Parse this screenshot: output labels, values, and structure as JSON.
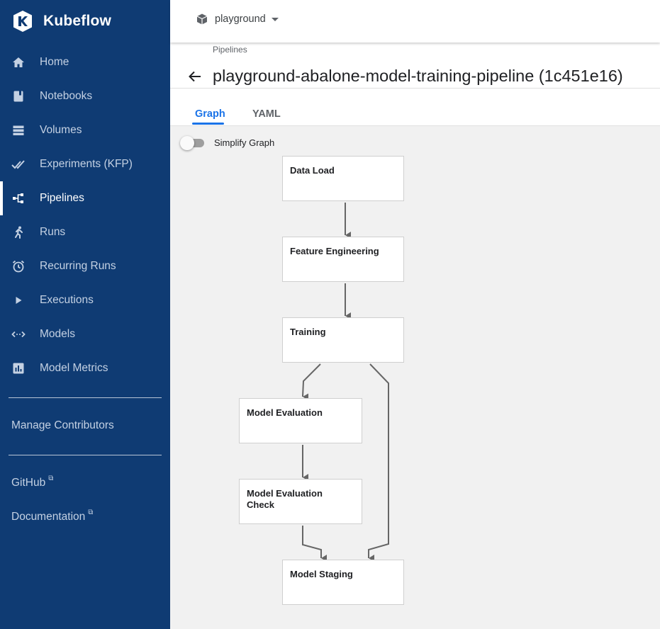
{
  "brand": {
    "name": "Kubeflow",
    "logo_icon": "kubeflow-logo-icon"
  },
  "sidebar": {
    "items": [
      {
        "label": "Home",
        "icon": "home-icon"
      },
      {
        "label": "Notebooks",
        "icon": "notebook-icon"
      },
      {
        "label": "Volumes",
        "icon": "storage-icon"
      },
      {
        "label": "Experiments (KFP)",
        "icon": "done-all-icon"
      },
      {
        "label": "Pipelines",
        "icon": "pipeline-icon",
        "active": true
      },
      {
        "label": "Runs",
        "icon": "runner-icon"
      },
      {
        "label": "Recurring Runs",
        "icon": "alarm-icon"
      },
      {
        "label": "Executions",
        "icon": "play-icon"
      },
      {
        "label": "Models",
        "icon": "code-arrows-icon"
      },
      {
        "label": "Model Metrics",
        "icon": "bar-chart-icon"
      }
    ],
    "manage_contributors": "Manage Contributors",
    "github": "GitHub",
    "documentation": "Documentation"
  },
  "topbar": {
    "namespace": "playground"
  },
  "header": {
    "breadcrumb": "Pipelines",
    "title": "playground-abalone-model-training-pipeline (1c451e16)"
  },
  "tabs": {
    "graph": "Graph",
    "yaml": "YAML",
    "active": "graph"
  },
  "graph": {
    "simplify_label": "Simplify Graph",
    "simplify_enabled": false,
    "nodes": {
      "data_load": "Data Load",
      "feature_engineering": "Feature Engineering",
      "training": "Training",
      "model_evaluation": "Model Evaluation",
      "model_evaluation_check": "Model Evaluation Check",
      "model_staging": "Model Staging"
    },
    "edges": [
      [
        "data_load",
        "feature_engineering"
      ],
      [
        "feature_engineering",
        "training"
      ],
      [
        "training",
        "model_evaluation"
      ],
      [
        "training",
        "model_staging"
      ],
      [
        "model_evaluation",
        "model_evaluation_check"
      ],
      [
        "model_evaluation_check",
        "model_staging"
      ]
    ]
  },
  "colors": {
    "sidebar_bg": "#0f3b73",
    "accent": "#1a73e8",
    "canvas_bg": "#f1f1f1",
    "edge": "#666666"
  }
}
